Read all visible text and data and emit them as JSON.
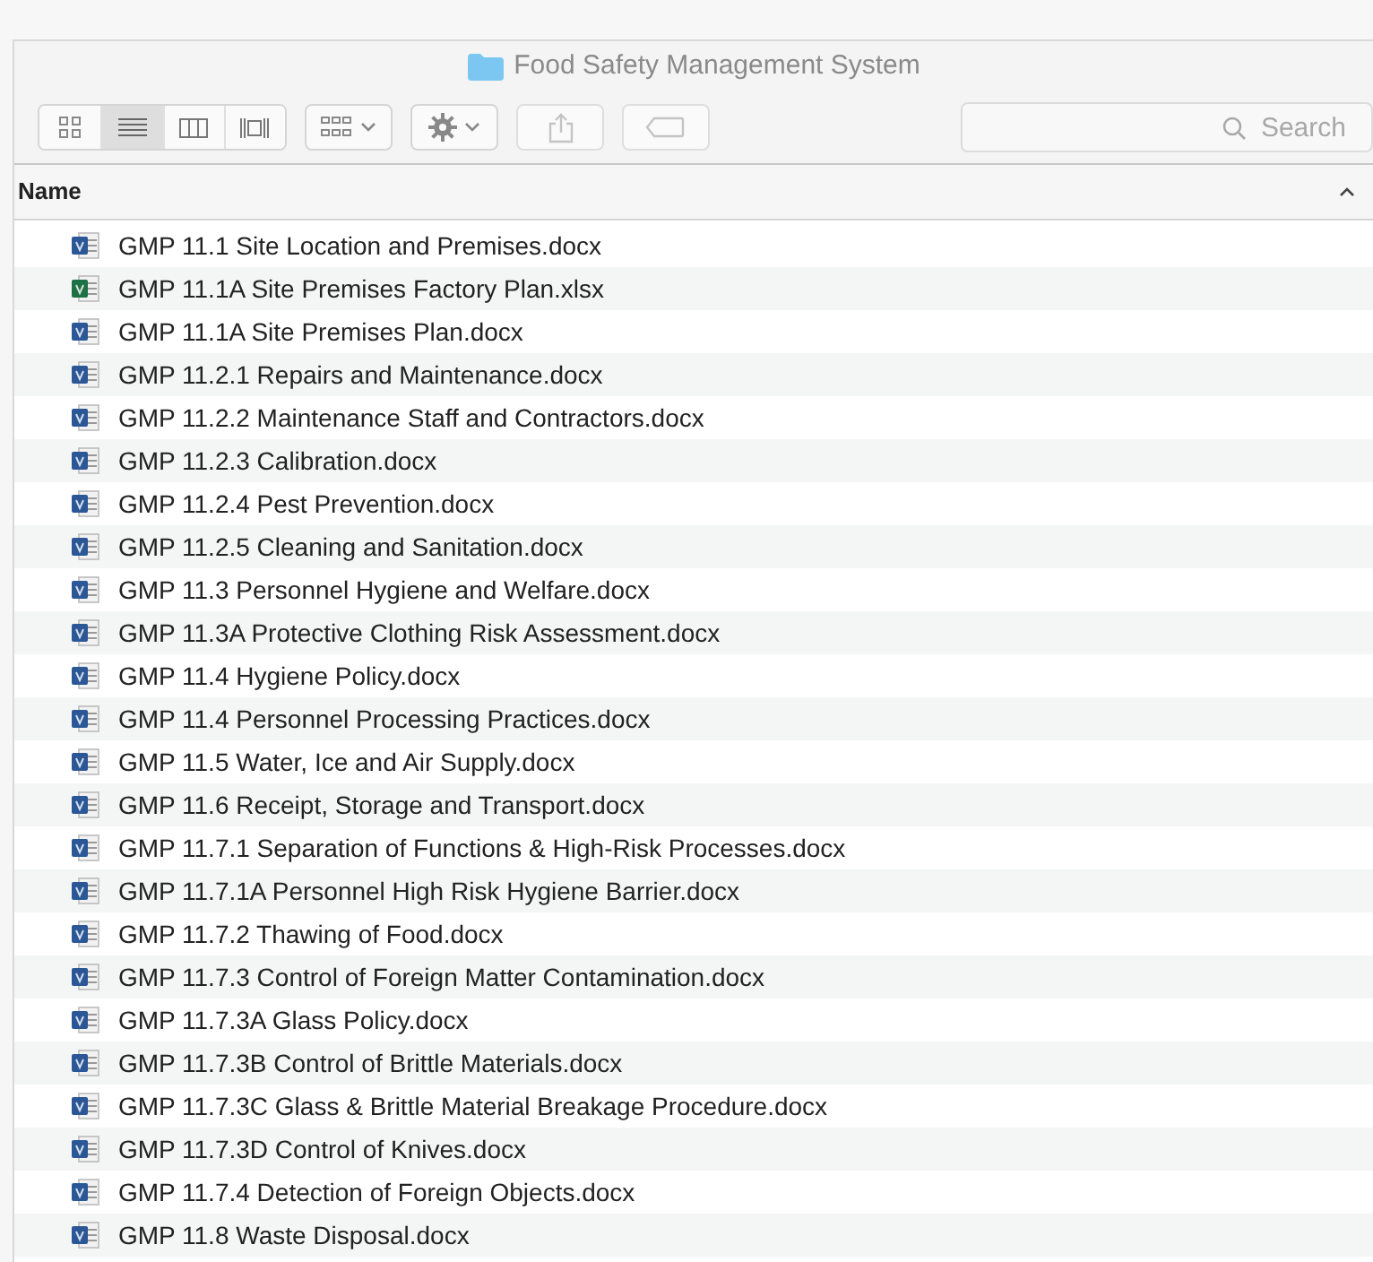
{
  "window": {
    "title": "Food Safety Management System"
  },
  "toolbar": {
    "view_buttons": [
      {
        "kind": "icons",
        "selected": false
      },
      {
        "kind": "list",
        "selected": true
      },
      {
        "kind": "columns",
        "selected": false
      },
      {
        "kind": "gallery",
        "selected": false
      }
    ],
    "search": {
      "placeholder": "Search"
    }
  },
  "table": {
    "columns": [
      {
        "label": "Name"
      }
    ],
    "rows": [
      {
        "name": "GMP 11.1 Site Location and Premises.docx",
        "kind": "word"
      },
      {
        "name": "GMP 11.1A Site Premises Factory Plan.xlsx",
        "kind": "excel"
      },
      {
        "name": "GMP 11.1A Site Premises Plan.docx",
        "kind": "word"
      },
      {
        "name": "GMP 11.2.1 Repairs and Maintenance.docx",
        "kind": "word"
      },
      {
        "name": "GMP 11.2.2 Maintenance Staff and Contractors.docx",
        "kind": "word"
      },
      {
        "name": "GMP 11.2.3 Calibration.docx",
        "kind": "word"
      },
      {
        "name": "GMP 11.2.4 Pest Prevention.docx",
        "kind": "word"
      },
      {
        "name": "GMP 11.2.5 Cleaning and Sanitation.docx",
        "kind": "word"
      },
      {
        "name": "GMP 11.3 Personnel Hygiene and Welfare.docx",
        "kind": "word"
      },
      {
        "name": "GMP 11.3A Protective Clothing Risk Assessment.docx",
        "kind": "word"
      },
      {
        "name": "GMP 11.4 Hygiene Policy.docx",
        "kind": "word"
      },
      {
        "name": "GMP 11.4 Personnel Processing Practices.docx",
        "kind": "word"
      },
      {
        "name": "GMP 11.5 Water, Ice and Air Supply.docx",
        "kind": "word"
      },
      {
        "name": "GMP 11.6 Receipt, Storage and Transport.docx",
        "kind": "word"
      },
      {
        "name": "GMP 11.7.1 Separation of Functions & High-Risk Processes.docx",
        "kind": "word"
      },
      {
        "name": "GMP 11.7.1A Personnel High Risk Hygiene Barrier.docx",
        "kind": "word"
      },
      {
        "name": "GMP 11.7.2 Thawing of Food.docx",
        "kind": "word"
      },
      {
        "name": "GMP 11.7.3 Control of Foreign Matter Contamination.docx",
        "kind": "word"
      },
      {
        "name": "GMP 11.7.3A Glass Policy.docx",
        "kind": "word"
      },
      {
        "name": "GMP 11.7.3B Control of Brittle Materials.docx",
        "kind": "word"
      },
      {
        "name": "GMP 11.7.3C Glass & Brittle Material Breakage Procedure.docx",
        "kind": "word"
      },
      {
        "name": "GMP 11.7.3D Control of Knives.docx",
        "kind": "word"
      },
      {
        "name": "GMP 11.7.4 Detection of Foreign Objects.docx",
        "kind": "word"
      },
      {
        "name": "GMP 11.8 Waste Disposal.docx",
        "kind": "word"
      }
    ]
  }
}
